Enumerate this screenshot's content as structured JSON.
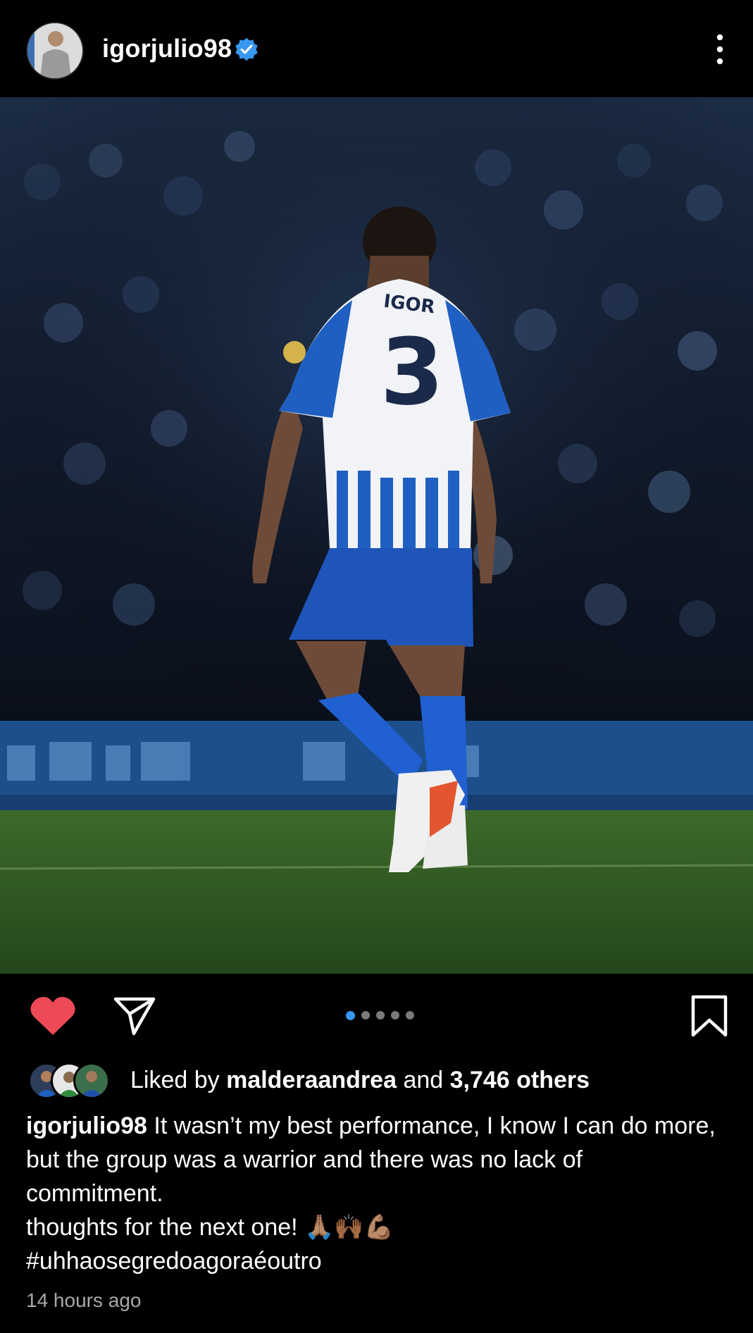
{
  "post": {
    "username": "igorjulio98",
    "verified": true,
    "avatar": "profile-photo",
    "more_icon": "more-vertical-icon"
  },
  "photo": {
    "jersey_name": "IGOR",
    "jersey_number": "3"
  },
  "actions": {
    "like_icon": "heart-filled-icon",
    "share_icon": "send-icon",
    "save_icon": "bookmark-icon",
    "liked": true,
    "carousel": {
      "count": 5,
      "active": 1
    }
  },
  "likes": {
    "prefix": "Liked by ",
    "user": "malderaandrea",
    "middle": " and ",
    "count": "3,746 others"
  },
  "caption": {
    "username": "igorjulio98",
    "text": "It wasn’t my best performance, I know I can do more, but the group was a warrior and there was no lack of commitment.",
    "line2": "thoughts for the next one! 🙏🏽🙌🏾💪🏽",
    "hashtag": "#uhhaosegredoagoraéoutro"
  },
  "timestamp": "14 hours ago",
  "colors": {
    "background": "#000000",
    "like_red": "#ed4956",
    "carousel_active": "#3897f0",
    "verified_blue": "#3897f0",
    "muted_text": "#a8a8a8"
  }
}
